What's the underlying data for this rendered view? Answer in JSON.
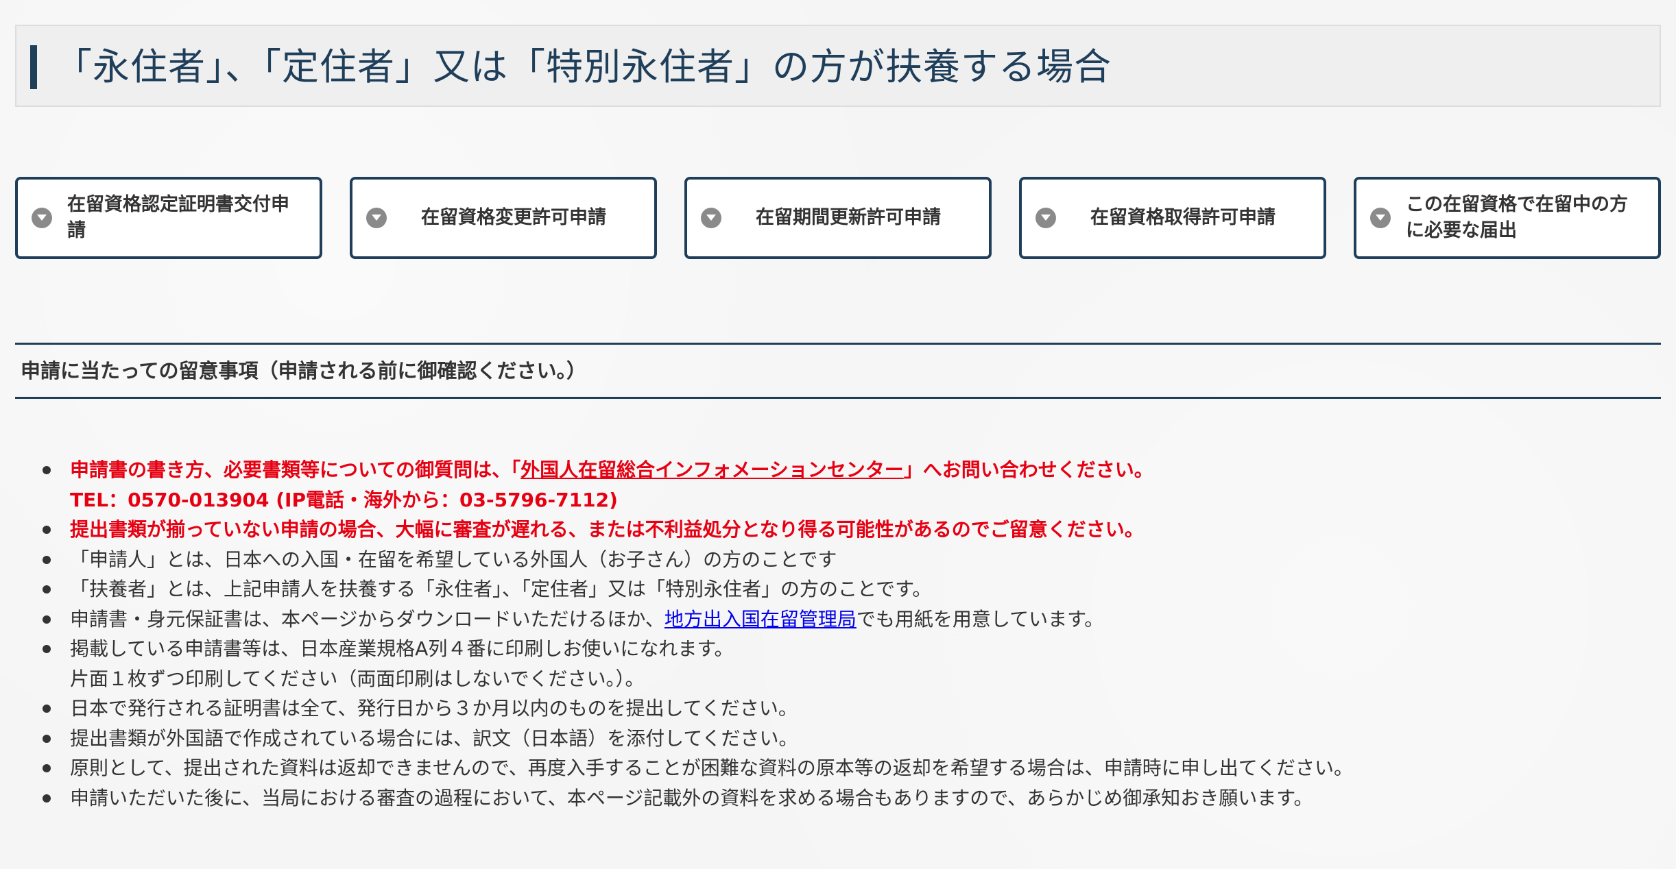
{
  "title": "「永住者」、「定住者」又は「特別永住者」の方が扶養する場合",
  "nav_buttons": [
    {
      "label": "在留資格認定証明書交付申請",
      "icon": "chevron-down-icon"
    },
    {
      "label": "在留資格変更許可申請",
      "icon": "chevron-down-icon"
    },
    {
      "label": "在留期間更新許可申請",
      "icon": "chevron-down-icon"
    },
    {
      "label": "在留資格取得許可申請",
      "icon": "chevron-down-icon"
    },
    {
      "label": "この在留資格で在留中の方に必要な届出",
      "icon": "chevron-down-icon"
    }
  ],
  "notes": {
    "title": "申請に当たっての留意事項（申請される前に御確認ください。）",
    "item1": {
      "before": "申請書の書き方、必要書類等についての御質問は、「",
      "link": "外国人在留総合インフォメーションセンター",
      "after": "」へお問い合わせください。",
      "tel": "TEL：0570-013904 (IP電話・海外から：03-5796-7112)"
    },
    "item2": "提出書類が揃っていない申請の場合、大幅に審査が遅れる、または不利益処分となり得る可能性があるのでご留意ください。",
    "item3": "「申請人」とは、日本への入国・在留を希望している外国人（お子さん）の方のことです",
    "item4": "「扶養者」とは、上記申請人を扶養する「永住者」、「定住者」又は「特別永住者」の方のことです。",
    "item5": {
      "before": "申請書・身元保証書は、本ページからダウンロードいただけるほか、",
      "link": "地方出入国在留管理局",
      "after": "でも用紙を用意しています。"
    },
    "item6": {
      "line1": "掲載している申請書等は、日本産業規格A列４番に印刷しお使いになれます。",
      "line2": "片面１枚ずつ印刷してください（両面印刷はしないでください。）。"
    },
    "item7": "日本で発行される証明書は全て、発行日から３か月以内のものを提出してください。",
    "item8": "提出書類が外国語で作成されている場合には、訳文（日本語）を添付してください。",
    "item9": "原則として、提出された資料は返却できませんので、再度入手することが困難な資料の原本等の返却を希望する場合は、申請時に申し出てください。",
    "item10": "申請いただいた後に、当局における審査の過程において、本ページ記載外の資料を求める場合もありますので、あらかじめ御承知おき願います。"
  },
  "colors": {
    "accent": "#1f3e5a",
    "warning": "#e60012",
    "link": "#0000ee",
    "text": "#333333"
  }
}
